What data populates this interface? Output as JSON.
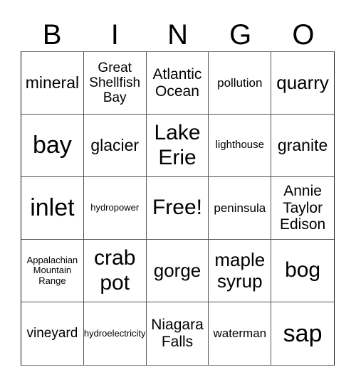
{
  "header": [
    "B",
    "I",
    "N",
    "G",
    "O"
  ],
  "cells": [
    [
      "mineral",
      "Great Shellfish Bay",
      "Atlantic Ocean",
      "pollution",
      "quarry"
    ],
    [
      "bay",
      "glacier",
      "Lake Erie",
      "lighthouse",
      "granite"
    ],
    [
      "inlet",
      "hydropower",
      "Free!",
      "peninsula",
      "Annie Taylor Edison"
    ],
    [
      "Appalachian Mountain Range",
      "crab pot",
      "gorge",
      "maple syrup",
      "bog"
    ],
    [
      "vineyard",
      "hydroelectricity",
      "Niagara Falls",
      "waterman",
      "sap"
    ]
  ]
}
